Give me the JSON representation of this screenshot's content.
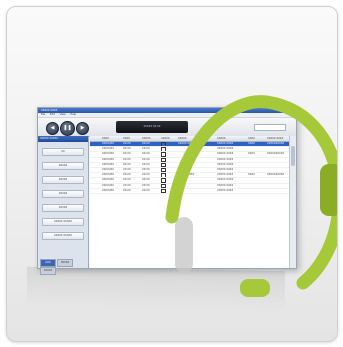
{
  "window": {
    "title": "XXXXX XXXX",
    "menu": [
      "File",
      "Edit",
      "View",
      "Help"
    ],
    "lcd_text": "XXXXX XX:XX"
  },
  "left_panel": {
    "header": "XXXXX XXXXX",
    "buttons": [
      "XX",
      "XXXXX",
      "XXXXX",
      "XXXXX",
      "XXXXX",
      "XXXXX XXXXX",
      "XXXXX XXXXX"
    ],
    "tabs": [
      "XXX",
      "XXXXX",
      "XXXXX"
    ]
  },
  "grid": {
    "columns": [
      "",
      "XXXX",
      "XXXX",
      "XXXXX",
      "XXXXX",
      "XXXXX",
      "XXXXX",
      "XXXX",
      "XXXXX XXXX"
    ],
    "rows": [
      [
        "",
        "XX/XX/XX",
        "XX:XX",
        "XX:XX",
        "",
        "XXXXX XXX XXXXX",
        "XXXXX XXXX",
        "XXXX",
        "XXXXXXXXXX"
      ],
      [
        "",
        "XX/XX/XX",
        "XX:XX",
        "XX:XX",
        "",
        "",
        "XXXXX XXXX",
        "",
        ""
      ],
      [
        "",
        "XX/XX/XX",
        "XX:XX",
        "XX:XX",
        "",
        "",
        "XXXXX XXXX",
        "XXXX",
        "XXXXXXXXXX"
      ],
      [
        "",
        "XX/XX/XX",
        "XX:XX",
        "XX:XX",
        "",
        "",
        "XXXXX XXXX",
        "",
        ""
      ],
      [
        "",
        "XX/XX/XX",
        "XX:XX",
        "XX:XX",
        "",
        "",
        "XXXXX XXXX",
        "",
        ""
      ],
      [
        "",
        "XX/XX/XX",
        "XX:XX",
        "XX:XX",
        "",
        "",
        "XXXXX XXXX",
        "",
        ""
      ],
      [
        "",
        "XX/XX/XX",
        "XX:XX",
        "XX:XX",
        "",
        "XXXXX XXXX",
        "XXXXX XXXX",
        "XXXX",
        "XXXXXXXXXX"
      ],
      [
        "",
        "XX/XX/XX",
        "XX:XX",
        "XX:XX",
        "",
        "",
        "XXXXX XXXX",
        "",
        ""
      ],
      [
        "",
        "XX/XX/XX",
        "XX:XX",
        "XX:XX",
        "",
        "",
        "XXXXX XXXX",
        "",
        ""
      ],
      [
        "",
        "XX/XX/XX",
        "XX:XX",
        "XX:XX",
        "",
        "",
        "XXXXX XXXX",
        "",
        ""
      ]
    ]
  },
  "colors": {
    "headset": "#a6c93a",
    "headset_dark": "#8aad25",
    "selection": "#2f63c1"
  },
  "icons": [
    "headset-icon",
    "previous-icon",
    "pause-icon",
    "next-icon"
  ]
}
